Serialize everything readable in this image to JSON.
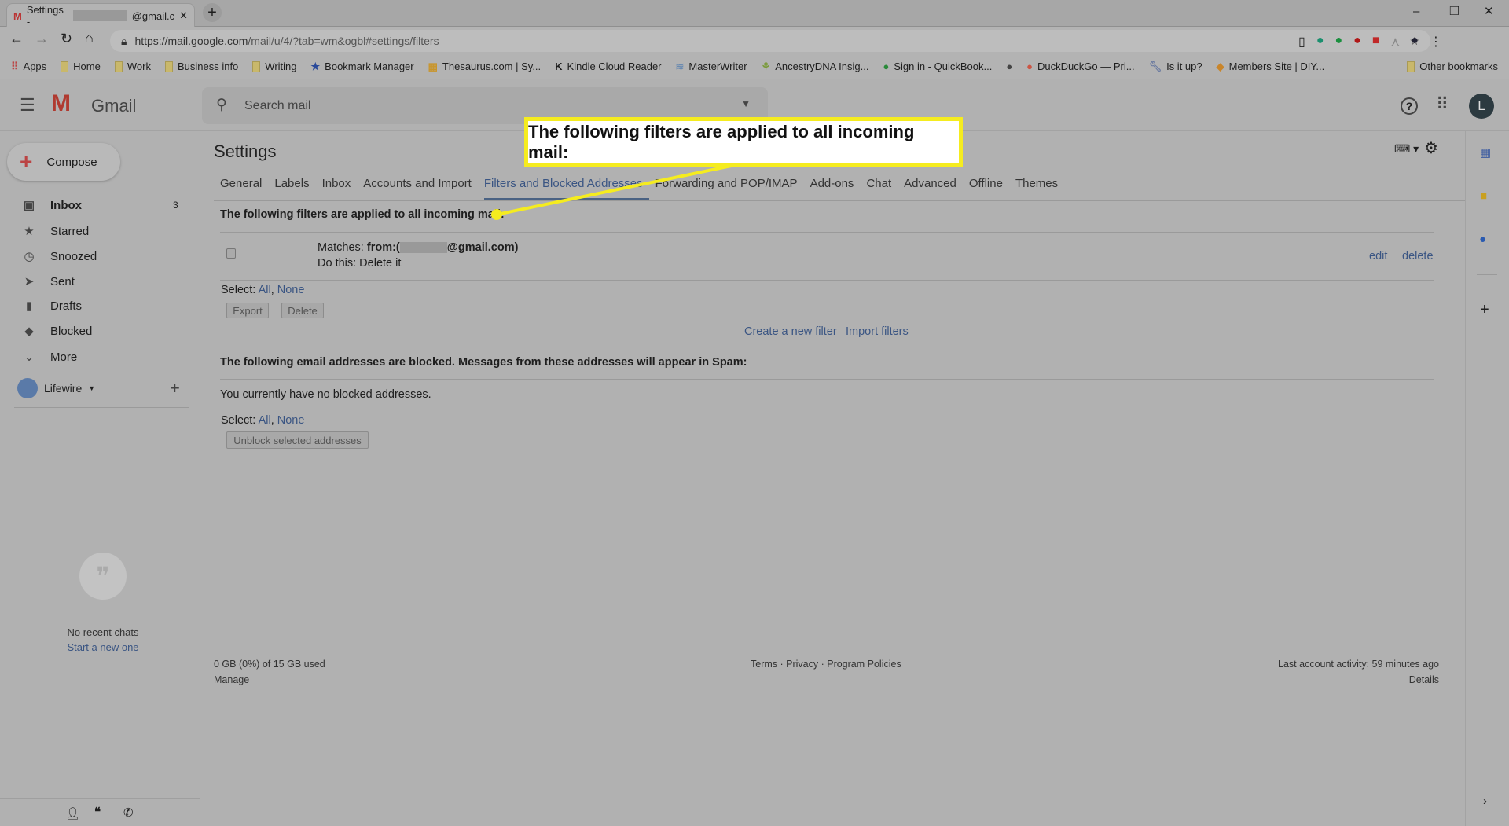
{
  "browser": {
    "tab_title": "Settings - ",
    "tab_title_suffix": "@gmail.c",
    "url_host": "https://mail.google.com",
    "url_path": "/mail/u/4/?tab=wm&ogbl#settings/filters",
    "bookmarks": [
      "Apps",
      "Home",
      "Work",
      "Business info",
      "Writing",
      "Bookmark Manager",
      "Thesaurus.com | Sy...",
      "Kindle Cloud Reader",
      "MasterWriter",
      "AncestryDNA Insig...",
      "Sign in - QuickBook...",
      "",
      "DuckDuckGo — Pri...",
      "Is it up?",
      "Members Site | DIY..."
    ],
    "other_bookmarks": "Other bookmarks"
  },
  "header": {
    "app_name": "Gmail",
    "search_placeholder": "Search mail",
    "avatar_letter": "L"
  },
  "sidebar": {
    "compose": "Compose",
    "items": [
      {
        "label": "Inbox",
        "count": "3",
        "icon": "inbox"
      },
      {
        "label": "Starred",
        "icon": "star"
      },
      {
        "label": "Snoozed",
        "icon": "clock"
      },
      {
        "label": "Sent",
        "icon": "send"
      },
      {
        "label": "Drafts",
        "icon": "file"
      },
      {
        "label": "Blocked",
        "icon": "label"
      },
      {
        "label": "More",
        "icon": "chevron-down"
      }
    ],
    "account": "Lifewire",
    "no_chats": "No recent chats",
    "start_chat": "Start a new one"
  },
  "settings": {
    "title": "Settings",
    "tabs": [
      "General",
      "Labels",
      "Inbox",
      "Accounts and Import",
      "Filters and Blocked Addresses",
      "Forwarding and POP/IMAP",
      "Add-ons",
      "Chat",
      "Advanced",
      "Offline",
      "Themes"
    ],
    "active_tab": 4,
    "filters_heading": "The following filters are applied to all incoming mail:",
    "filter": {
      "matches_label": "Matches: ",
      "matches_value": "from:(",
      "matches_suffix": "@gmail.com)",
      "action": "Do this: Delete it",
      "edit": "edit",
      "delete": "delete"
    },
    "select_label": "Select: ",
    "select_all": "All",
    "select_none": "None",
    "export": "Export",
    "delete_btn": "Delete",
    "create_filter": "Create a new filter",
    "import_filters": "Import filters",
    "blocked_heading": "The following email addresses are blocked. Messages from these addresses will appear in Spam:",
    "no_blocked": "You currently have no blocked addresses.",
    "unblock": "Unblock selected addresses"
  },
  "footer": {
    "storage": "0 GB (0%) of 15 GB used",
    "manage": "Manage",
    "terms": "Terms",
    "privacy": "Privacy",
    "policies": "Program Policies",
    "activity": "Last account activity: 59 minutes ago",
    "details": "Details"
  },
  "callout": {
    "text": "The following filters are applied to all incoming mail:",
    "color": "#f5ec1f"
  }
}
